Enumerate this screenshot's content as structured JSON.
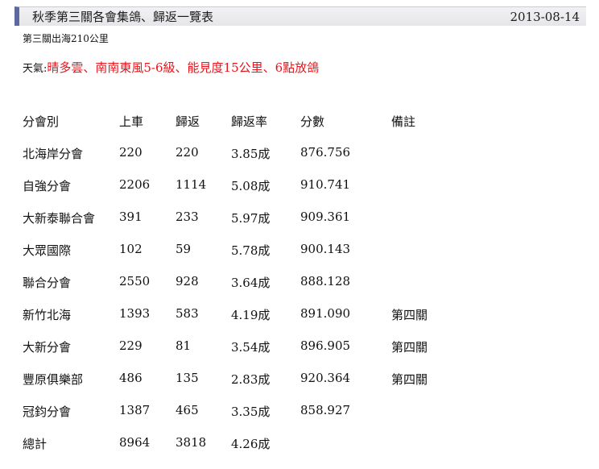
{
  "header": {
    "title": "秋季第三關各會集鴿、歸返一覽表",
    "date": "2013-08-14"
  },
  "race": {
    "subtitle": "第三關出海210公里",
    "weather_label": "天氣:",
    "weather_text": "晴多雲、南南東風5-6級、能見度15公里、6點放鴿"
  },
  "table": {
    "headers": [
      "分會別",
      "上車",
      "歸返",
      "歸返率",
      "分數",
      "備註"
    ],
    "rows": [
      [
        "北海岸分會",
        "220",
        "220",
        "3.85成",
        "876.756",
        ""
      ],
      [
        "自強分會",
        "2206",
        "1114",
        "5.08成",
        "910.741",
        ""
      ],
      [
        "大新泰聯合會",
        "391",
        "233",
        "5.97成",
        "909.361",
        ""
      ],
      [
        "大眾國際",
        "102",
        "59",
        "5.78成",
        "900.143",
        ""
      ],
      [
        "聯合分會",
        "2550",
        "928",
        "3.64成",
        "888.128",
        ""
      ],
      [
        "新竹北海",
        "1393",
        "583",
        "4.19成",
        "891.090",
        "第四關"
      ],
      [
        "大新分會",
        "229",
        "81",
        "3.54成",
        "896.905",
        "第四關"
      ],
      [
        "豐原俱樂部",
        "486",
        "135",
        "2.83成",
        "920.364",
        "第四關"
      ],
      [
        "冠鈞分會",
        "1387",
        "465",
        "3.35成",
        "858.927",
        ""
      ],
      [
        "總計",
        "8964",
        "3818",
        "4.26成",
        "",
        ""
      ]
    ]
  }
}
